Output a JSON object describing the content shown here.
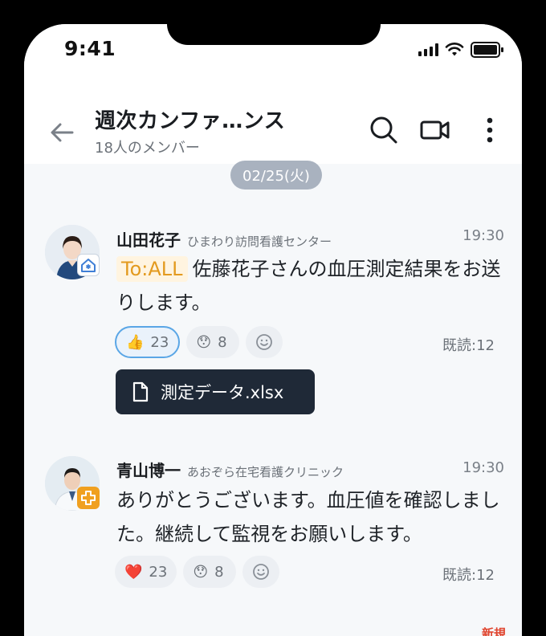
{
  "status": {
    "time": "9:41"
  },
  "header": {
    "title": "週次カンファ…ンス",
    "subtitle": "18人のメンバー"
  },
  "date_chip": "02/25(火)",
  "messages": [
    {
      "name": "山田花子",
      "org": "ひまわり訪問看護センター",
      "time": "19:30",
      "mention": "To:ALL",
      "text": "佐藤花子さんの血圧測定結果をお送りします。",
      "reactions": [
        {
          "emoji": "👍",
          "count": "23",
          "active": true
        },
        {
          "emoji": "😯",
          "count": "8",
          "active": false
        }
      ],
      "read": "既読:12",
      "attachment": "測定データ.xlsx",
      "badge_color": "#3f7fd6"
    },
    {
      "name": "青山博一",
      "org": "あおぞら在宅看護クリニック",
      "time": "19:30",
      "text": "ありがとうございます。血圧値を確認しました。継続して監視をお願いします。",
      "reactions": [
        {
          "emoji": "❤️",
          "count": "23",
          "active": false
        },
        {
          "emoji": "😯",
          "count": "8",
          "active": false
        }
      ],
      "read": "既読:12",
      "badge_color": "#f0a020"
    }
  ],
  "new_label": "新規",
  "icons": {
    "back": "arrow-left-icon",
    "search": "search-icon",
    "video": "video-camera-icon",
    "more": "more-vertical-icon",
    "add_reaction": "smiley-add-icon",
    "file": "document-icon"
  }
}
